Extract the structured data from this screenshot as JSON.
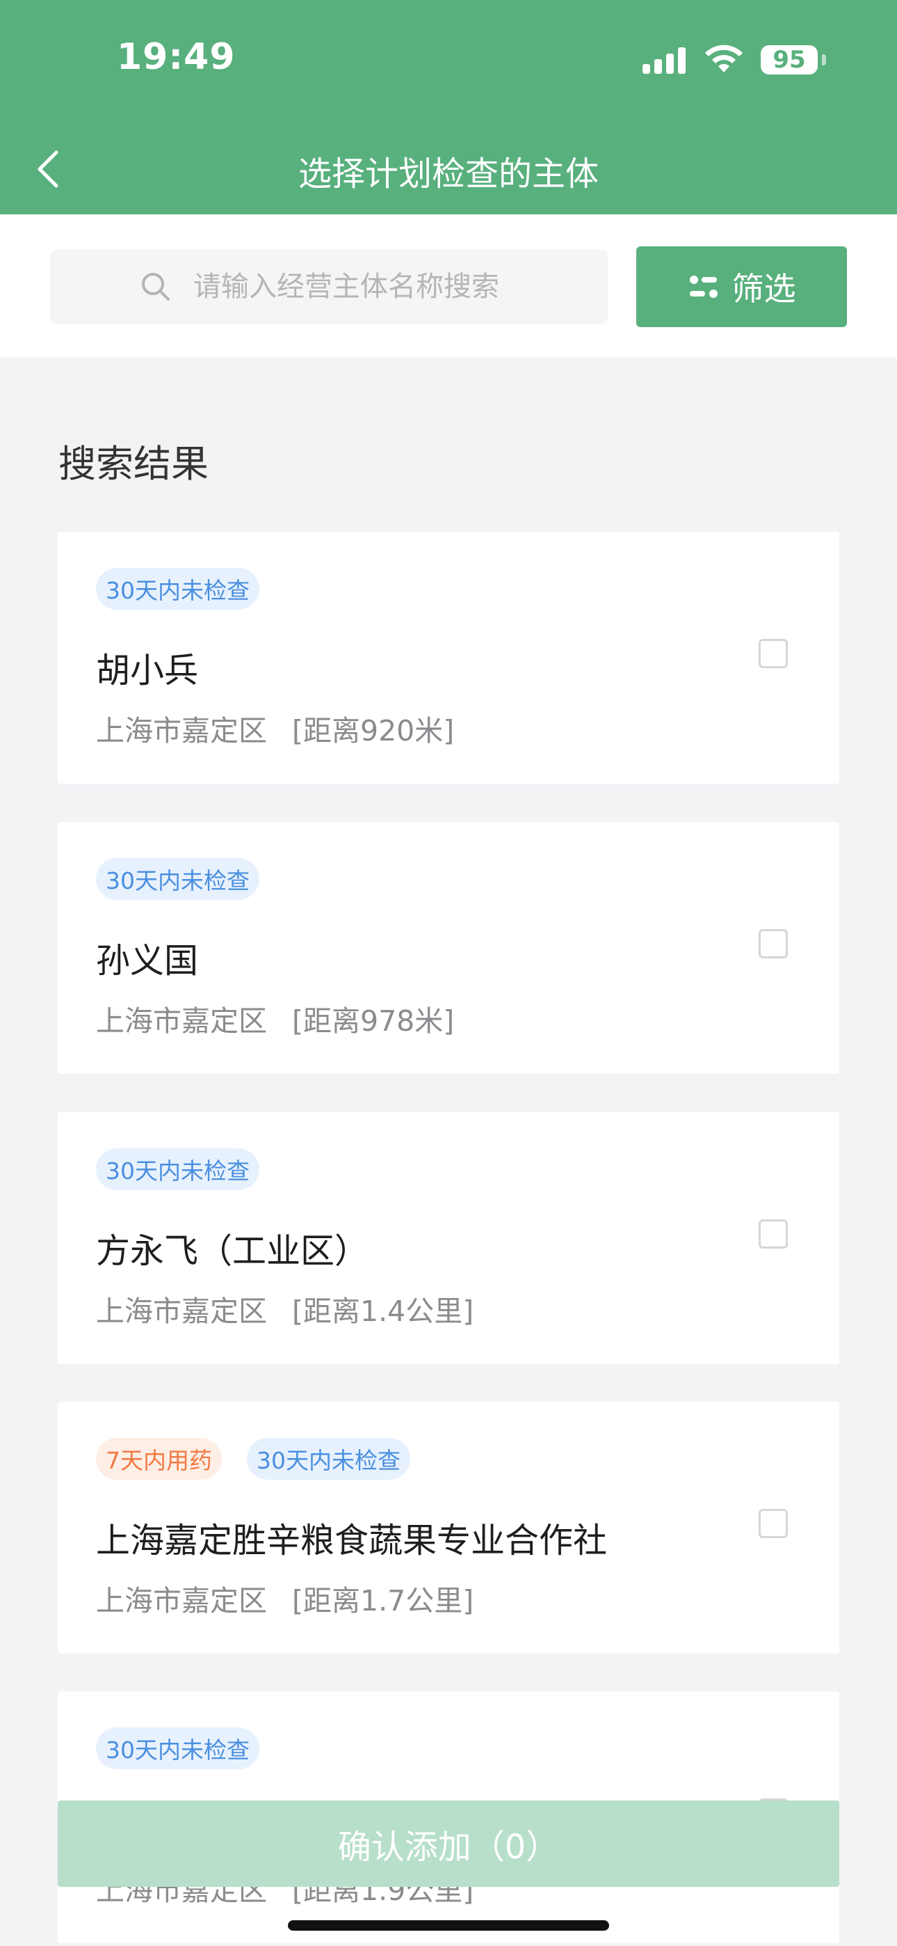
{
  "status_bar": {
    "time": "19:49",
    "battery": "95"
  },
  "nav": {
    "title": "选择计划检查的主体",
    "back_icon": "chevron-left-icon"
  },
  "search": {
    "placeholder": "请输入经营主体名称搜索",
    "filter_label": "筛选"
  },
  "results": {
    "title": "搜索结果",
    "items": [
      {
        "tags": [
          {
            "label": "30天内未检查",
            "color": "blue"
          }
        ],
        "name": "胡小兵",
        "address": "上海市嘉定区",
        "distance": "[距离920米]",
        "checked": false
      },
      {
        "tags": [
          {
            "label": "30天内未检查",
            "color": "blue"
          }
        ],
        "name": "孙义国",
        "address": "上海市嘉定区",
        "distance": "[距离978米]",
        "checked": false
      },
      {
        "tags": [
          {
            "label": "30天内未检查",
            "color": "blue"
          }
        ],
        "name": "方永飞（工业区）",
        "address": "上海市嘉定区",
        "distance": "[距离1.4公里]",
        "checked": false
      },
      {
        "tags": [
          {
            "label": "7天内用药",
            "color": "orange"
          },
          {
            "label": "30天内未检查",
            "color": "blue"
          }
        ],
        "name": "上海嘉定胜辛粮食蔬果专业合作社",
        "address": "上海市嘉定区",
        "distance": "[距离1.7公里]",
        "checked": false
      },
      {
        "tags": [
          {
            "label": "30天内未检查",
            "color": "blue"
          }
        ],
        "name": "",
        "address": "上海市嘉定区",
        "distance": "[距离1.9公里]",
        "checked": false
      }
    ]
  },
  "footer": {
    "confirm_label": "确认添加（0）"
  },
  "colors": {
    "primary": "#58b07d",
    "primary_disabled": "#b7dfc9",
    "tag_blue_text": "#4a8fe0",
    "tag_blue_bg": "#e7f1fd",
    "tag_orange_text": "#f27a43",
    "tag_orange_bg": "#fdeee6"
  }
}
